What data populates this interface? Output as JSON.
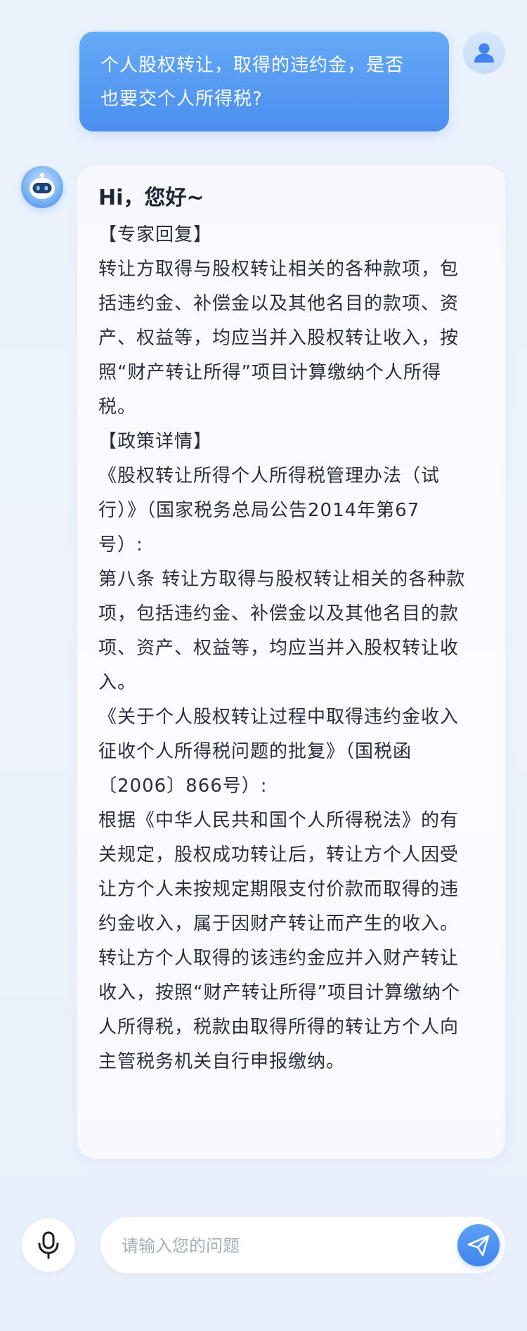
{
  "user_message": {
    "lines": [
      "个人股权转让，取得的违约金，是否",
      "也要交个人所得税?"
    ],
    "avatar_icon": "user-icon"
  },
  "bot_message": {
    "avatar_icon": "robot-icon",
    "greeting": "Hi，您好~",
    "lines": [
      "【专家回复】",
      "转让方取得与股权转让相关的各种款项，包",
      "括违约金、补偿金以及其他名目的款项、资",
      "产、权益等，均应当并入股权转让收入，按",
      "照“财产转让所得”项目计算缴纳个人所得",
      "税。",
      "【政策详情】",
      "《股权转让所得个人所得税管理办法（试",
      "行）》（国家税务总局公告2014年第67",
      "号）:",
      "第八条  转让方取得与股权转让相关的各种款",
      "项，包括违约金、补偿金以及其他名目的款",
      "项、资产、权益等，均应当并入股权转让收",
      "入。",
      "《关于个人股权转让过程中取得违约金收入",
      "征收个人所得税问题的批复》（国税函",
      "〔2006〕866号）:",
      "根据《中华人民共和国个人所得税法》的有",
      "关规定，股权成功转让后，转让方个人因受",
      "让方个人未按规定期限支付价款而取得的违",
      "约金收入，属于因财产转让而产生的收入。",
      "转让方个人取得的该违约金应并入财产转让",
      "收入，按照“财产转让所得”项目计算缴纳个",
      "人所得税，税款由取得所得的转让方个人向",
      "主管税务机关自行申报缴纳。"
    ]
  },
  "input_bar": {
    "placeholder": "请输入您的问题",
    "value": "",
    "mic_icon": "microphone-icon",
    "send_icon": "send-icon"
  },
  "colors": {
    "accent": "#4b8ef0",
    "user_bubble_top": "#64aaf6",
    "background": "#eaf2fc"
  }
}
